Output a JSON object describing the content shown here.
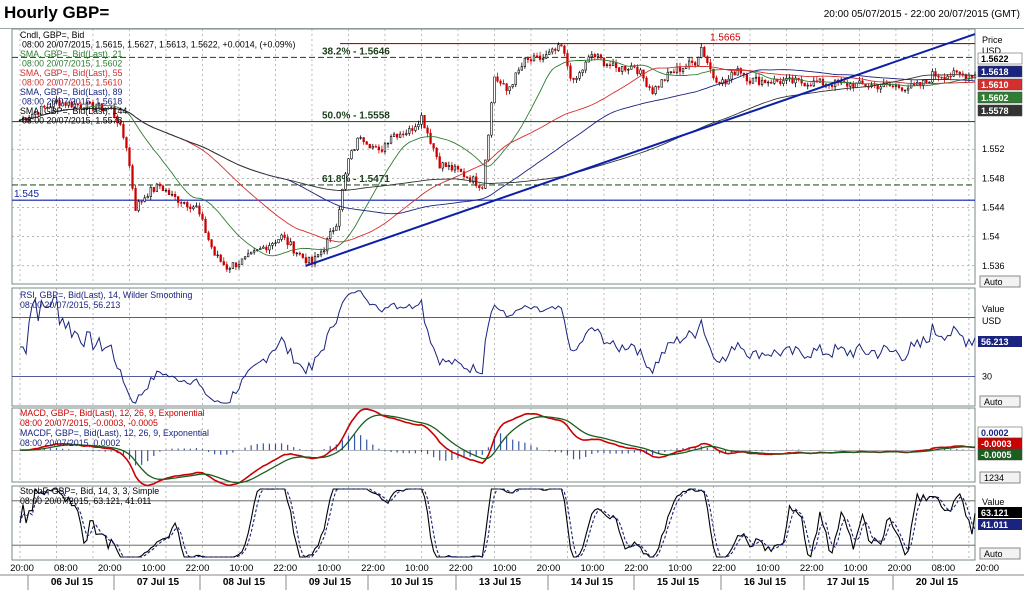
{
  "header": {
    "title": "Hourly GBP=",
    "range": "20:00 05/07/2015 - 22:00 20/07/2015 (GMT)"
  },
  "colors": {
    "up": "#000000",
    "down": "#cc0000",
    "sma21": "#2e7d32",
    "sma55": "#d32f2f",
    "sma89": "#1a237e",
    "sma144": "#333333",
    "trend": "#0d1fa8",
    "grid": "#9e9e9e",
    "rsi": "#1a237e",
    "macd": "#cc0000",
    "signal": "#1b5e20",
    "hist": "#3355aa",
    "stoch_k": "#000000",
    "stoch_d": "#1a237e"
  },
  "price_panel": {
    "legend": [
      "Cndl, GBP=, Bid",
      "08:00 20/07/2015, 1.5615, 1.5627, 1.5613, 1.5622, +0.0014, (+0.09%)",
      "SMA, GBP=, Bid(Last), 21",
      "08:00 20/07/2015, 1.5602",
      "SMA, GBP=, Bid(Last), 55",
      "08:00 20/07/2015, 1.5610",
      "SMA, GBP=, Bid(Last), 89",
      "08:00 20/07/2015, 1.5618",
      "SMA, GBP=, Bid(Last), 144",
      "08:00 20/07/2015, 1.5578"
    ],
    "axis_unit_top": "Price",
    "axis_unit": "USD",
    "auto_label": "Auto",
    "ticks": [
      "1.536",
      "1.54",
      "1.544",
      "1.548",
      "1.552"
    ],
    "tags": [
      {
        "label": "1.5622",
        "value": 1.5622,
        "bg": "#ffffff",
        "fg": "#000000"
      },
      {
        "label": "1.5618",
        "value": 1.5618,
        "bg": "#1a237e",
        "fg": "#ffffff"
      },
      {
        "label": "1.5610",
        "value": 1.561,
        "bg": "#d32f2f",
        "fg": "#ffffff"
      },
      {
        "label": "1.5602",
        "value": 1.5602,
        "bg": "#2e7d32",
        "fg": "#ffffff"
      },
      {
        "label": "1.5578",
        "value": 1.5578,
        "bg": "#333333",
        "fg": "#ffffff"
      }
    ],
    "levels": [
      {
        "label": "1.5665",
        "value": 1.5665,
        "color": "#cc0000"
      },
      {
        "label": "38.2% - 1.5646",
        "value": 1.5646,
        "color": "#2e5a2e"
      },
      {
        "label": "50.0% - 1.5558",
        "value": 1.5558,
        "color": "#2e5a2e"
      },
      {
        "label": "61.8% - 1.5471",
        "value": 1.5471,
        "color": "#2e5a2e"
      },
      {
        "label": "1.545",
        "value": 1.545,
        "color": "#0d1fa8"
      }
    ]
  },
  "rsi_panel": {
    "legend": [
      "RSI, GBP=, Bid(Last), 14, Wilder Smoothing",
      "08:00 20/07/2015, 56.213"
    ],
    "axis_unit_top": "Value",
    "axis_unit": "USD",
    "tick_30": "30",
    "tag": "56.213",
    "auto_label": "Auto"
  },
  "macd_panel": {
    "legend": [
      "MACD, GBP=, Bid(Last), 12, 26, 9, Exponential",
      "08:00 20/07/2015, -0.0003, -0.0005",
      "MACDF, GBP=, Bid(Last), 12, 26, 9, Exponential",
      "08:00 20/07/2015, 0.0002"
    ],
    "tags": [
      {
        "label": "0.0002",
        "bg": "#ffffff",
        "fg": "#1a237e"
      },
      {
        "label": "-0.0003",
        "bg": "#cc0000",
        "fg": "#ffffff"
      },
      {
        "label": "-0.0005",
        "bg": "#1b5e20",
        "fg": "#ffffff"
      }
    ],
    "scale_label": "1234"
  },
  "stoch_panel": {
    "legend": [
      "StochF, GBP=, Bid, 14, 3, 3, Simple",
      "08:00 20/07/2015, 63.121, 41.011"
    ],
    "axis_unit_top": "Value",
    "tags": [
      {
        "label": "63.121",
        "bg": "#000000",
        "fg": "#ffffff"
      },
      {
        "label": "41.011",
        "bg": "#1a237e",
        "fg": "#ffffff"
      }
    ],
    "auto_label": "Auto"
  },
  "x_axis": {
    "times": [
      "20:00",
      "08:00",
      "20:00",
      "10:00",
      "22:00",
      "10:00",
      "22:00",
      "10:00",
      "22:00",
      "10:00",
      "22:00",
      "10:00",
      "20:00",
      "10:00",
      "22:00",
      "10:00",
      "22:00",
      "10:00",
      "22:00",
      "10:00",
      "20:00",
      "08:00",
      "20:00"
    ],
    "days": [
      "06 Jul 15",
      "07 Jul 15",
      "08 Jul 15",
      "09 Jul 15",
      "10 Jul 15",
      "13 Jul 15",
      "14 Jul 15",
      "15 Jul 15",
      "16 Jul 15",
      "17 Jul 15",
      "20 Jul 15"
    ]
  },
  "chart_data": {
    "type": "candlestick",
    "title": "Hourly GBP=",
    "timeframe": "hourly",
    "x_range": [
      "2015-07-05 20:00",
      "2015-07-20 22:00"
    ],
    "ylim": [
      1.5335,
      1.5685
    ],
    "price_anchors": [
      [
        "2015-07-05 20:00",
        1.556
      ],
      [
        "2015-07-06 08:00",
        1.5585
      ],
      [
        "2015-07-06 20:00",
        1.5578
      ],
      [
        "2015-07-07 02:00",
        1.5575
      ],
      [
        "2015-07-07 04:00",
        1.556
      ],
      [
        "2015-07-07 07:00",
        1.5525
      ],
      [
        "2015-07-07 10:00",
        1.544
      ],
      [
        "2015-07-07 14:00",
        1.546
      ],
      [
        "2015-07-07 18:00",
        1.547
      ],
      [
        "2015-07-07 22:00",
        1.5455
      ],
      [
        "2015-07-08 06:00",
        1.544
      ],
      [
        "2015-07-08 12:00",
        1.5375
      ],
      [
        "2015-07-08 16:00",
        1.5358
      ],
      [
        "2015-07-08 22:00",
        1.5368
      ],
      [
        "2015-07-09 04:00",
        1.5385
      ],
      [
        "2015-07-09 10:00",
        1.54
      ],
      [
        "2015-07-09 16:00",
        1.5375
      ],
      [
        "2015-07-09 20:00",
        1.5363
      ],
      [
        "2015-07-10 00:00",
        1.5385
      ],
      [
        "2015-07-10 04:00",
        1.542
      ],
      [
        "2015-07-10 08:00",
        1.5505
      ],
      [
        "2015-07-10 12:00",
        1.554
      ],
      [
        "2015-07-10 18:00",
        1.5515
      ],
      [
        "2015-07-12 22:00",
        1.554
      ],
      [
        "2015-07-13 04:00",
        1.5545
      ],
      [
        "2015-07-13 08:00",
        1.5565
      ],
      [
        "2015-07-13 14:00",
        1.55
      ],
      [
        "2015-07-13 20:00",
        1.549
      ],
      [
        "2015-07-14 04:00",
        1.547
      ],
      [
        "2015-07-14 08:00",
        1.562
      ],
      [
        "2015-07-14 12:00",
        1.56
      ],
      [
        "2015-07-14 18:00",
        1.564
      ],
      [
        "2015-07-15 00:00",
        1.5645
      ],
      [
        "2015-07-15 06:00",
        1.566
      ],
      [
        "2015-07-15 10:00",
        1.561
      ],
      [
        "2015-07-15 16:00",
        1.565
      ],
      [
        "2015-07-16 00:00",
        1.563
      ],
      [
        "2015-07-16 06:00",
        1.5635
      ],
      [
        "2015-07-16 12:00",
        1.56
      ],
      [
        "2015-07-16 18:00",
        1.5625
      ],
      [
        "2015-07-17 02:00",
        1.564
      ],
      [
        "2015-07-17 04:00",
        1.566
      ],
      [
        "2015-07-17 08:00",
        1.562
      ],
      [
        "2015-07-17 12:00",
        1.561
      ],
      [
        "2015-07-17 16:00",
        1.5632
      ],
      [
        "2015-07-17 20:00",
        1.5615
      ],
      [
        "2015-07-20 02:00",
        1.5605
      ],
      [
        "2015-07-20 06:00",
        1.5612
      ],
      [
        "2015-07-20 08:00",
        1.5622
      ]
    ],
    "last_candle": {
      "time": "2015-07-20 08:00",
      "open": 1.5615,
      "high": 1.5627,
      "low": 1.5613,
      "close": 1.5622,
      "change": 0.0014,
      "change_pct": 0.09
    },
    "sma_last": {
      "sma21": 1.5602,
      "sma55": 1.561,
      "sma89": 1.5618,
      "sma144": 1.5578
    },
    "trendline": [
      [
        "2015-07-09 18:00",
        1.536
      ],
      [
        "2015-07-20 22:00",
        1.5678
      ]
    ],
    "rsi": {
      "period": 14,
      "last": 56.213,
      "ylim": [
        10,
        90
      ],
      "levels": [
        30,
        70
      ]
    },
    "macd": {
      "fast": 12,
      "slow": 26,
      "signal": 9,
      "last_macd": -0.0003,
      "last_signal": -0.0005,
      "last_hist": 0.0002,
      "ylim": [
        -0.003,
        0.004
      ]
    },
    "stochastic": {
      "k_period": 14,
      "d_period": 3,
      "slowing": 3,
      "last_k": 63.121,
      "last_d": 41.011,
      "ylim": [
        0,
        100
      ],
      "levels": [
        20,
        80
      ]
    }
  }
}
